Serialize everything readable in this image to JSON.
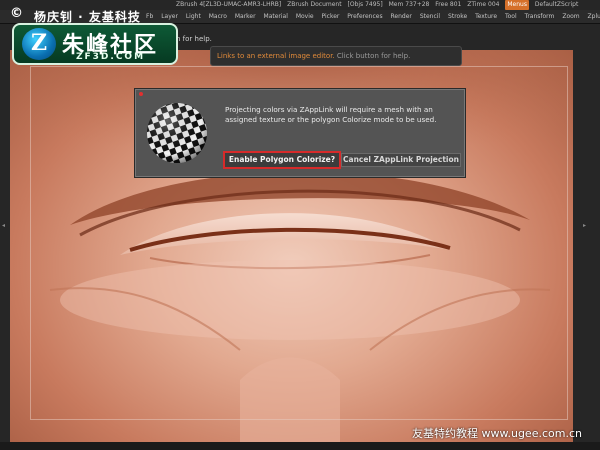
{
  "title_bar": {
    "app": "ZBrush 4[ZL3D-UMAC-AMR3-LHRB]",
    "document": "ZBrush Document",
    "objs": "[Objs 7495]",
    "mem": "Mem 737+28",
    "free": "Free 801",
    "ztime": "ZTime 004",
    "menus": "Menus",
    "script": "DefaultZScript"
  },
  "menu_bar": {
    "items": [
      "Fb",
      "Layer",
      "Light",
      "Macro",
      "Marker",
      "Material",
      "Movie",
      "Picker",
      "Preferences",
      "Render",
      "Stencil",
      "Stroke",
      "Texture",
      "Tool",
      "Transform",
      "Zoom",
      "Zplugin"
    ]
  },
  "help_hint": "n for help.",
  "logo": {
    "copyright": "©",
    "author": "杨庆钊 · 友基科技",
    "z_mark": "Z",
    "brand_cn": "朱峰社区",
    "brand_url": "ZF3D.COM"
  },
  "tooltip": {
    "orange_text": "Links to an external image editor.",
    "grey_text": "Click button for help."
  },
  "dialog": {
    "message": "Projecting colors via ZAppLink will require a mesh with an assigned texture or the polygon Colorize mode to be used.",
    "enable_button": "Enable Polygon Colorize?",
    "cancel_button": "Cancel ZAppLink Projection"
  },
  "bottom_watermark": "友基特约教程  www.ugee.com.cn",
  "colors": {
    "accent_orange": "#d5702a",
    "highlight_red": "#d62a2a",
    "skin_base": "#e2a990"
  }
}
